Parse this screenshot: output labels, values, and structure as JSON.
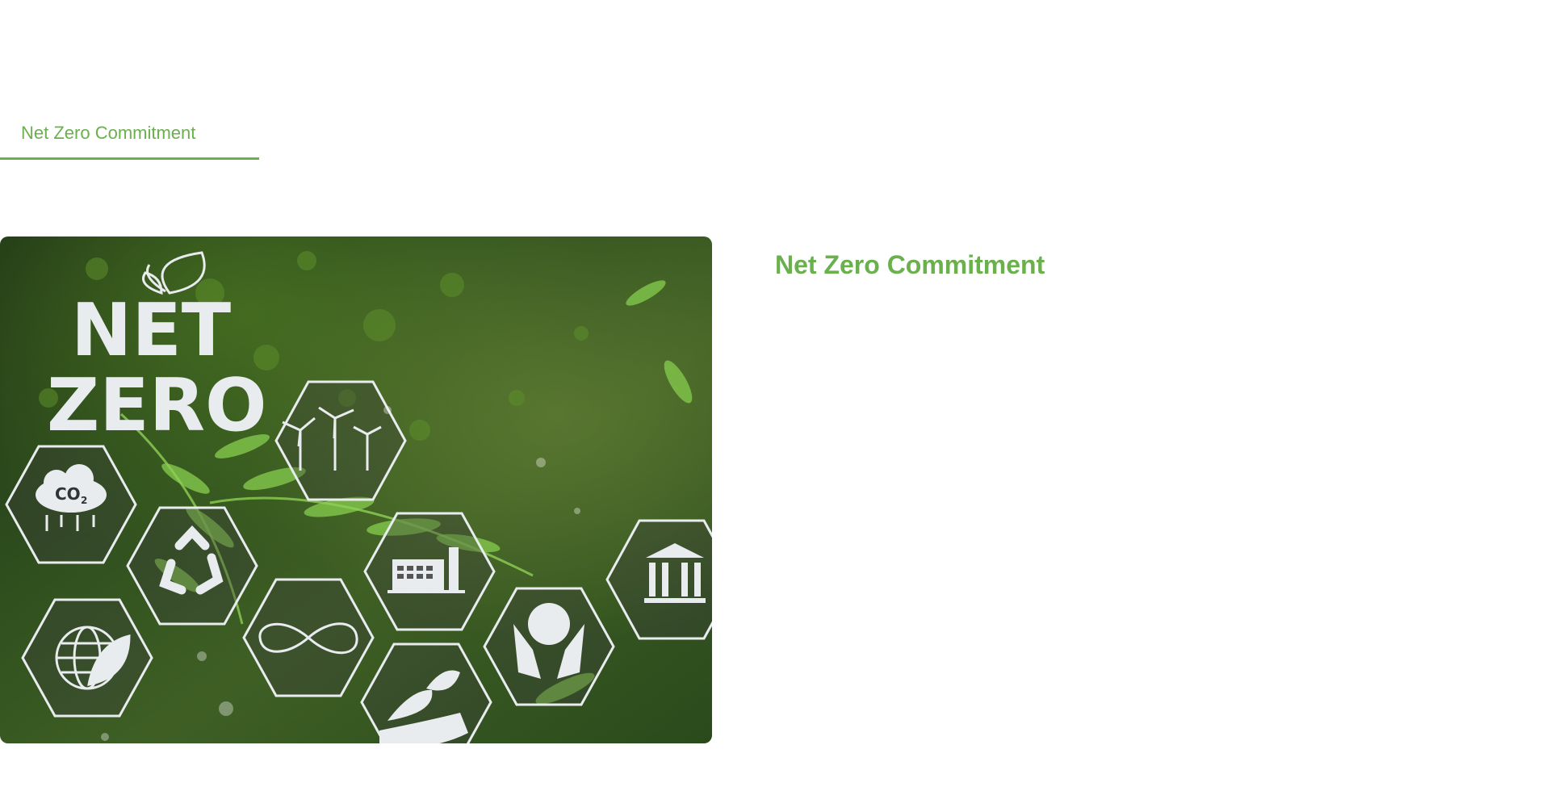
{
  "tabs": [
    {
      "label": "Net Zero Commitment",
      "active": true
    }
  ],
  "hero_image": {
    "line1": "NET",
    "line2": "ZERO",
    "co2_label": "CO",
    "co2_sub": "2",
    "icons": [
      "leaves-icon",
      "wind-turbine-icon",
      "co2-cloud-icon",
      "recycle-icon",
      "factory-icon",
      "bank-icon",
      "globe-leaf-icon",
      "infinity-icon",
      "hand-earth-icon",
      "hand-plant-icon"
    ]
  },
  "content": {
    "heading": "Net Zero Commitment"
  },
  "colors": {
    "accent": "#6ab04c",
    "background": "#ffffff"
  }
}
